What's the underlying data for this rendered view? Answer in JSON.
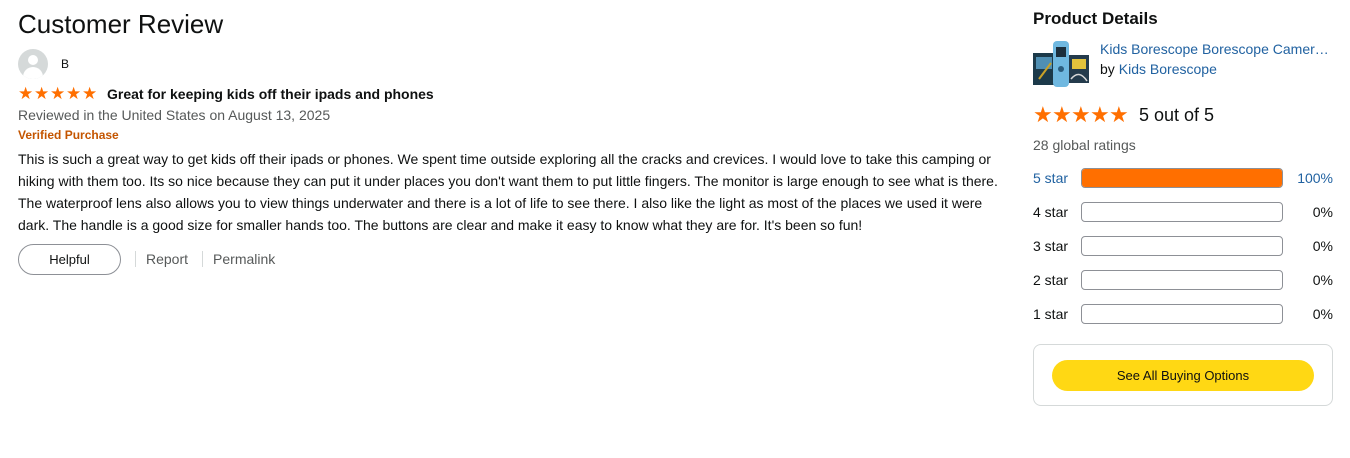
{
  "review": {
    "page_title": "Customer Review",
    "profile_name": "B",
    "rating": 5,
    "title": "Great for keeping kids off their ipads and phones",
    "date": "Reviewed in the United States on August 13, 2025",
    "verified": "Verified Purchase",
    "body": "This is such a great way to get kids off their ipads or phones. We spent time outside exploring all the cracks and crevices. I would love to take this camping or hiking with them too. Its so nice because they can put it under places you don't want them to put little fingers. The monitor is large enough to see what is there. The waterproof lens also allows you to view things underwater and there is a lot of life to see there. I also like the light as most of the places we used it were dark. The handle is a good size for smaller hands too. The buttons are clear and make it easy to know what they are for. It's been so fun!",
    "helpful_label": "Helpful",
    "report_label": "Report",
    "permalink_label": "Permalink"
  },
  "product": {
    "heading": "Product Details",
    "name": "Kids Borescope Borescope Camera for Kids",
    "by_label": "by",
    "brand": "Kids Borescope",
    "rating": 5,
    "rating_text": "5 out of 5",
    "global_ratings": "28 global ratings",
    "histogram": [
      {
        "label": "5 star",
        "percent_text": "100%",
        "fraction": 1.0
      },
      {
        "label": "4 star",
        "percent_text": "0%",
        "fraction": 0
      },
      {
        "label": "3 star",
        "percent_text": "0%",
        "fraction": 0
      },
      {
        "label": "2 star",
        "percent_text": "0%",
        "fraction": 0
      },
      {
        "label": "1 star",
        "percent_text": "0%",
        "fraction": 0
      }
    ],
    "buy_label": "See All Buying Options"
  },
  "colors": {
    "star": "#ff6f00",
    "link": "#2162a1",
    "verified": "#c45500",
    "buy_button": "#ffd814"
  }
}
